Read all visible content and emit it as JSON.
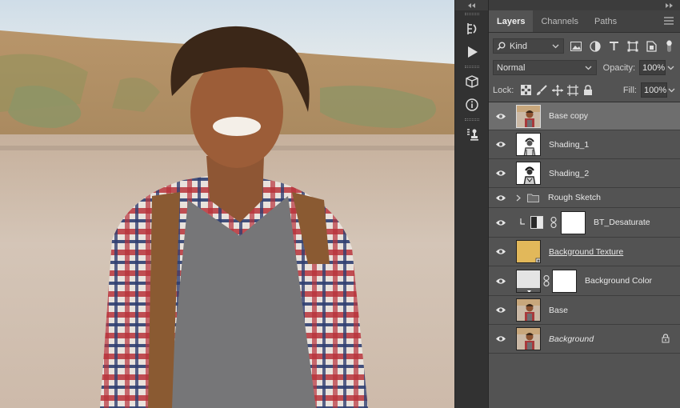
{
  "panel": {
    "tabs": [
      {
        "label": "Layers",
        "active": true
      },
      {
        "label": "Channels",
        "active": false
      },
      {
        "label": "Paths",
        "active": false
      }
    ],
    "filter": {
      "kind_label": "Kind"
    },
    "blend_mode": "Normal",
    "opacity_label": "Opacity:",
    "opacity_value": "100%",
    "lock_label": "Lock:",
    "fill_label": "Fill:",
    "fill_value": "100%"
  },
  "layers": [
    {
      "name": "Base copy",
      "selected": true,
      "thumb": "photo"
    },
    {
      "name": "Shading_1",
      "thumb": "sketch"
    },
    {
      "name": "Shading_2",
      "thumb": "sketch"
    },
    {
      "name": "Rough Sketch",
      "type": "group"
    },
    {
      "name": "BT_Desaturate",
      "type": "adjustment"
    },
    {
      "name": "Background Texture",
      "thumb": "texture"
    },
    {
      "name": "Background Color",
      "type": "fill"
    },
    {
      "name": "Base",
      "thumb": "photo"
    },
    {
      "name": "Background",
      "thumb": "photo",
      "locked": true
    }
  ],
  "colors": {
    "panel_bg": "#535353",
    "selected_layer": "#6e6e6e",
    "texture_swatch": "#e2b85a"
  }
}
